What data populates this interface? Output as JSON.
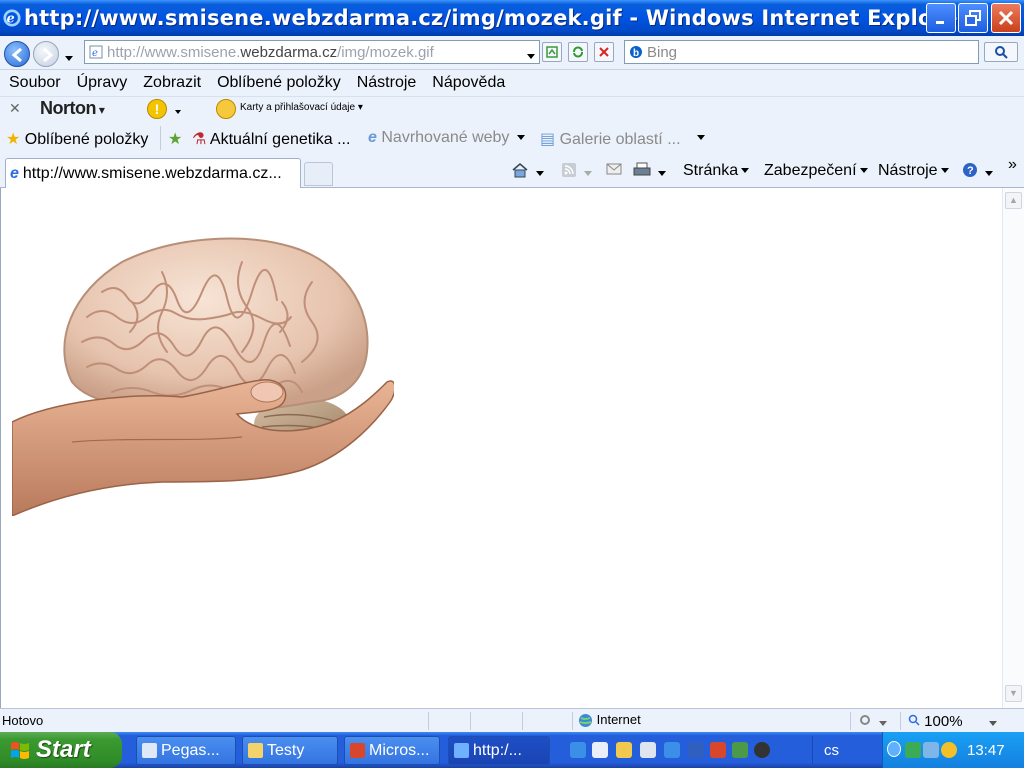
{
  "window": {
    "title": "http://www.smisene.webzdarma.cz/img/mozek.gif - Windows Internet Explorer"
  },
  "address": {
    "url_prefix": "http://www.smisene.",
    "url_host": "webzdarma.cz",
    "url_suffix": "/img/mozek.gif",
    "search_placeholder": "Bing"
  },
  "menu": {
    "items": [
      "Soubor",
      "Úpravy",
      "Zobrazit",
      "Oblíbené položky",
      "Nástroje",
      "Nápověda"
    ]
  },
  "norton": {
    "brand": "Norton",
    "cards_label": "Karty a přihlašovací údaje"
  },
  "favorites": {
    "button_label": "Oblíbené položky",
    "items": [
      "Aktuální genetika ...",
      "Navrhované weby",
      "Galerie oblastí ..."
    ]
  },
  "tabs": {
    "active_label": "http://www.smisene.webzdarma.cz..."
  },
  "commandbar": {
    "page_label": "Stránka",
    "security_label": "Zabezpečení",
    "tools_label": "Nástroje",
    "more": "»"
  },
  "statusbar": {
    "status_text": "Hotovo",
    "zone_text": "Internet",
    "zoom_text": "100%"
  },
  "taskbar": {
    "start_label": "Start",
    "tasks": [
      "Pegas...",
      "Testy",
      "Micros...",
      "http:/..."
    ],
    "language": "cs",
    "clock": "13:47"
  },
  "colors": {
    "titlebar": "#0054e3",
    "taskbar": "#245edb",
    "start_green": "#3c9a32",
    "chrome_bg": "#ecf2fb"
  }
}
